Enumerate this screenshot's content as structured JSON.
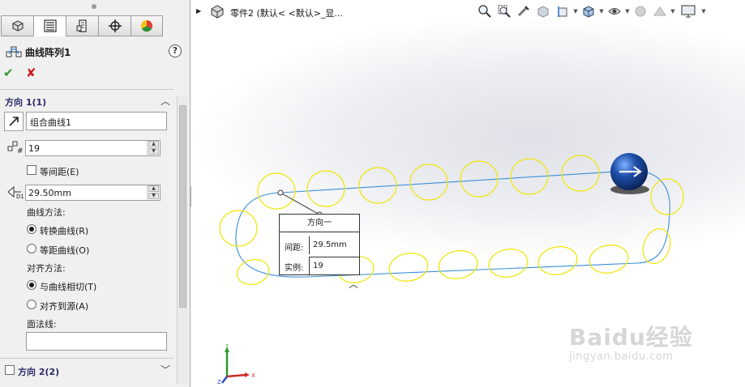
{
  "panel": {
    "tabs": [
      {
        "name": "feature-manager-tab-icon"
      },
      {
        "name": "property-manager-tab-icon"
      },
      {
        "name": "configuration-manager-tab-icon"
      },
      {
        "name": "dimxpert-manager-tab-icon"
      },
      {
        "name": "display-manager-tab-icon"
      }
    ],
    "title": "曲线阵列1",
    "help_label": "?",
    "ok_label": "✔",
    "cancel_label": "✘",
    "direction1": {
      "header": "方向 1(1)",
      "path_value": "组合曲线1",
      "instances_value": "19",
      "equal_spacing_label": "等间距(E)",
      "equal_spacing_checked": false,
      "spacing_value": "29.50mm",
      "curve_method_label": "曲线方法:",
      "curve_methods": [
        {
          "label": "转换曲线(R)",
          "selected": true
        },
        {
          "label": "等距曲线(O)",
          "selected": false
        }
      ],
      "align_method_label": "对齐方法:",
      "align_methods": [
        {
          "label": "与曲线相切(T)",
          "selected": true
        },
        {
          "label": "对齐到源(A)",
          "selected": false
        }
      ],
      "face_normal_label": "面法线:",
      "face_normal_value": ""
    },
    "direction2": {
      "header": "方向 2(2)",
      "checked": false
    }
  },
  "viewport": {
    "part_title": "零件2  (默认< <默认>_显...",
    "heads_up_icons": [
      "zoom-to-fit-icon",
      "zoom-to-area-icon",
      "previous-view-icon",
      "section-view-icon",
      "dynamic-annotation-icon",
      "view-orientation-icon",
      "display-style-icon",
      "hide-show-items-icon",
      "edit-appearance-icon",
      "apply-scene-icon",
      "view-settings-icon"
    ],
    "callout": {
      "title": "方向一",
      "spacing_key": "间距:",
      "spacing_value": "29.5mm",
      "instances_key": "实例:",
      "instances_value": "19"
    },
    "triad": {
      "x_label": "X",
      "y_label": "Y",
      "z_label": "Z"
    },
    "watermark": {
      "main": "Baidu经验",
      "sub": "jingyan.baidu.com"
    },
    "colors": {
      "curve": "#3a8fd8",
      "instance": "#f0e614",
      "seed": "#1e4fa8"
    }
  }
}
